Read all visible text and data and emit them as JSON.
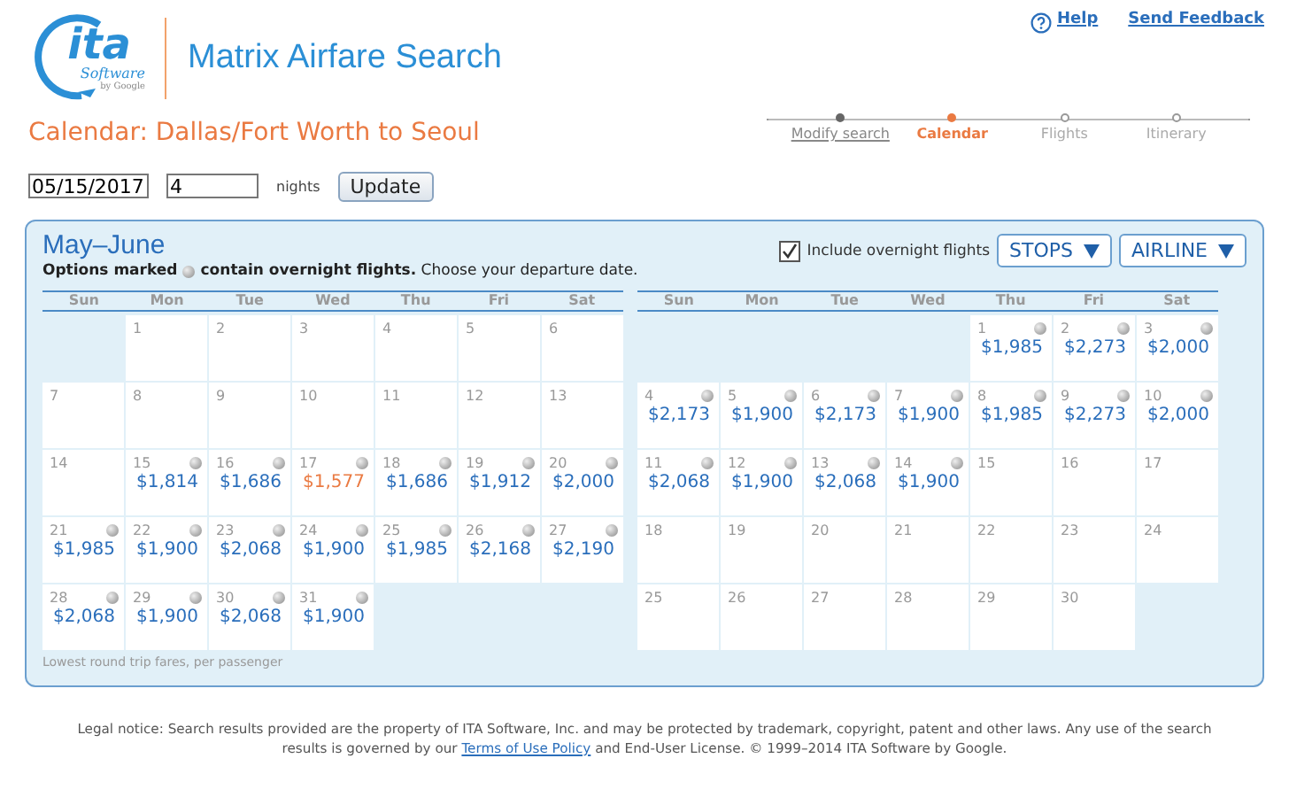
{
  "logo": {
    "wordmark": "ita",
    "subtitle": "Software",
    "byline": "by Google"
  },
  "app_title": "Matrix Airfare Search",
  "header_links": [
    {
      "label": "Help",
      "kind": "help"
    },
    {
      "label": "Send Feedback",
      "kind": "plain"
    }
  ],
  "page_title": "Calendar: Dallas/Fort Worth to Seoul",
  "steps": [
    {
      "label": "Modify search",
      "selected": false,
      "done": true
    },
    {
      "label": "Calendar",
      "selected": true,
      "done": false
    },
    {
      "label": "Flights",
      "selected": false,
      "done": false
    },
    {
      "label": "Itinerary",
      "selected": false,
      "done": false
    }
  ],
  "search": {
    "date": "05/15/2017",
    "nights": "4",
    "nights_label": "nights",
    "button": "Update"
  },
  "calendar": {
    "title": "May–June",
    "legend_lead": "Options marked",
    "legend_tail": "**contain overnight flights.** Choose your departure date.",
    "overnight_filter": {
      "label": "Include overnight flights",
      "checked": true
    },
    "filters": [
      {
        "label": "STOPS"
      },
      {
        "label": "AIRLINE"
      }
    ],
    "months": [
      {
        "weekdays": [
          "Sun",
          "Mon",
          "Tue",
          "Wed",
          "Thu",
          "Fri",
          "Sat"
        ],
        "weeks": [
          [
            {
              "kind": "blank"
            },
            {
              "kind": "day",
              "day": "1",
              "overnight": false
            },
            {
              "kind": "day",
              "day": "2",
              "overnight": false
            },
            {
              "kind": "day",
              "day": "3",
              "overnight": false
            },
            {
              "kind": "day",
              "day": "4",
              "overnight": false
            },
            {
              "kind": "day",
              "day": "5",
              "overnight": false
            },
            {
              "kind": "day",
              "day": "6",
              "overnight": false
            }
          ],
          [
            {
              "kind": "day",
              "day": "7",
              "overnight": false
            },
            {
              "kind": "day",
              "day": "8",
              "overnight": false
            },
            {
              "kind": "day",
              "day": "9",
              "overnight": false
            },
            {
              "kind": "day",
              "day": "10",
              "overnight": false
            },
            {
              "kind": "day",
              "day": "11",
              "overnight": false
            },
            {
              "kind": "day",
              "day": "12",
              "overnight": false
            },
            {
              "kind": "day",
              "day": "13",
              "overnight": false
            }
          ],
          [
            {
              "kind": "day",
              "day": "14",
              "overnight": false
            },
            {
              "kind": "day",
              "day": "15",
              "overnight": true,
              "price": "$1,814",
              "cheapest": false
            },
            {
              "kind": "day",
              "day": "16",
              "overnight": true,
              "price": "$1,686",
              "cheapest": false
            },
            {
              "kind": "day",
              "day": "17",
              "overnight": true,
              "price": "$1,577",
              "cheapest": true
            },
            {
              "kind": "day",
              "day": "18",
              "overnight": true,
              "price": "$1,686",
              "cheapest": false
            },
            {
              "kind": "day",
              "day": "19",
              "overnight": true,
              "price": "$1,912",
              "cheapest": false
            },
            {
              "kind": "day",
              "day": "20",
              "overnight": true,
              "price": "$2,000",
              "cheapest": false
            }
          ],
          [
            {
              "kind": "day",
              "day": "21",
              "overnight": true,
              "price": "$1,985",
              "cheapest": false
            },
            {
              "kind": "day",
              "day": "22",
              "overnight": true,
              "price": "$1,900",
              "cheapest": false
            },
            {
              "kind": "day",
              "day": "23",
              "overnight": true,
              "price": "$2,068",
              "cheapest": false
            },
            {
              "kind": "day",
              "day": "24",
              "overnight": true,
              "price": "$1,900",
              "cheapest": false
            },
            {
              "kind": "day",
              "day": "25",
              "overnight": true,
              "price": "$1,985",
              "cheapest": false
            },
            {
              "kind": "day",
              "day": "26",
              "overnight": true,
              "price": "$2,168",
              "cheapest": false
            },
            {
              "kind": "day",
              "day": "27",
              "overnight": true,
              "price": "$2,190",
              "cheapest": false
            }
          ],
          [
            {
              "kind": "day",
              "day": "28",
              "overnight": true,
              "price": "$2,068",
              "cheapest": false
            },
            {
              "kind": "day",
              "day": "29",
              "overnight": true,
              "price": "$1,900",
              "cheapest": false
            },
            {
              "kind": "day",
              "day": "30",
              "overnight": true,
              "price": "$2,068",
              "cheapest": false
            },
            {
              "kind": "day",
              "day": "31",
              "overnight": true,
              "price": "$1,900",
              "cheapest": false
            }
          ]
        ]
      },
      {
        "weekdays": [
          "Sun",
          "Mon",
          "Tue",
          "Wed",
          "Thu",
          "Fri",
          "Sat"
        ],
        "weeks": [
          [
            {
              "kind": "blank"
            },
            {
              "kind": "blank"
            },
            {
              "kind": "blank"
            },
            {
              "kind": "blank"
            },
            {
              "kind": "day",
              "day": "1",
              "overnight": true,
              "price": "$1,985",
              "cheapest": false
            },
            {
              "kind": "day",
              "day": "2",
              "overnight": true,
              "price": "$2,273",
              "cheapest": false
            },
            {
              "kind": "day",
              "day": "3",
              "overnight": true,
              "price": "$2,000",
              "cheapest": false
            }
          ],
          [
            {
              "kind": "day",
              "day": "4",
              "overnight": true,
              "price": "$2,173",
              "cheapest": false
            },
            {
              "kind": "day",
              "day": "5",
              "overnight": true,
              "price": "$1,900",
              "cheapest": false
            },
            {
              "kind": "day",
              "day": "6",
              "overnight": true,
              "price": "$2,173",
              "cheapest": false
            },
            {
              "kind": "day",
              "day": "7",
              "overnight": true,
              "price": "$1,900",
              "cheapest": false
            },
            {
              "kind": "day",
              "day": "8",
              "overnight": true,
              "price": "$1,985",
              "cheapest": false
            },
            {
              "kind": "day",
              "day": "9",
              "overnight": true,
              "price": "$2,273",
              "cheapest": false
            },
            {
              "kind": "day",
              "day": "10",
              "overnight": true,
              "price": "$2,000",
              "cheapest": false
            }
          ],
          [
            {
              "kind": "day",
              "day": "11",
              "overnight": true,
              "price": "$2,068",
              "cheapest": false
            },
            {
              "kind": "day",
              "day": "12",
              "overnight": true,
              "price": "$1,900",
              "cheapest": false
            },
            {
              "kind": "day",
              "day": "13",
              "overnight": true,
              "price": "$2,068",
              "cheapest": false
            },
            {
              "kind": "day",
              "day": "14",
              "overnight": true,
              "price": "$1,900",
              "cheapest": false
            },
            {
              "kind": "day",
              "day": "15",
              "overnight": false
            },
            {
              "kind": "day",
              "day": "16",
              "overnight": false
            },
            {
              "kind": "day",
              "day": "17",
              "overnight": false
            }
          ],
          [
            {
              "kind": "day",
              "day": "18",
              "overnight": false
            },
            {
              "kind": "day",
              "day": "19",
              "overnight": false
            },
            {
              "kind": "day",
              "day": "20",
              "overnight": false
            },
            {
              "kind": "day",
              "day": "21",
              "overnight": false
            },
            {
              "kind": "day",
              "day": "22",
              "overnight": false
            },
            {
              "kind": "day",
              "day": "23",
              "overnight": false
            },
            {
              "kind": "day",
              "day": "24",
              "overnight": false
            }
          ],
          [
            {
              "kind": "day",
              "day": "25",
              "overnight": false
            },
            {
              "kind": "day",
              "day": "26",
              "overnight": false
            },
            {
              "kind": "day",
              "day": "27",
              "overnight": false
            },
            {
              "kind": "day",
              "day": "28",
              "overnight": false
            },
            {
              "kind": "day",
              "day": "29",
              "overnight": false
            },
            {
              "kind": "day",
              "day": "30",
              "overnight": false
            }
          ]
        ]
      }
    ],
    "footnote": "Lowest round trip fares, per passenger"
  },
  "legal": {
    "text_before": "Legal notice: Search results provided are the property of ITA Software, Inc. and may be protected by trademark, copyright, patent and other laws. Any use of the search results is governed by our",
    "link": "Terms of Use Policy",
    "text_after": "and End-User License. © 1999–2014 ITA Software by Google."
  }
}
